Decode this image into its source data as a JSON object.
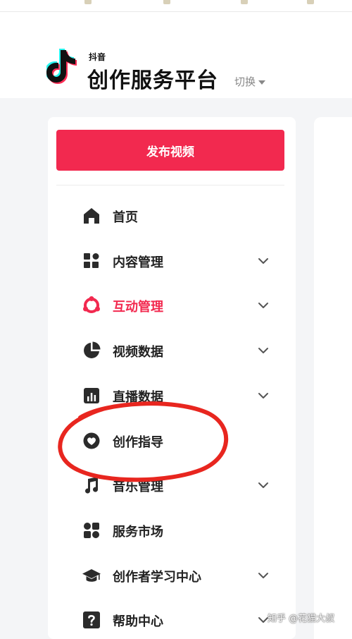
{
  "header": {
    "logo_small": "抖音",
    "logo_main": "创作服务平台",
    "switch_label": "切换"
  },
  "sidebar": {
    "publish_label": "发布视频",
    "items": [
      {
        "label": "首页",
        "icon": "home-icon",
        "expandable": false,
        "active": false
      },
      {
        "label": "内容管理",
        "icon": "content-grid-icon",
        "expandable": true,
        "active": false
      },
      {
        "label": "互动管理",
        "icon": "interaction-icon",
        "expandable": true,
        "active": true
      },
      {
        "label": "视频数据",
        "icon": "pie-chart-icon",
        "expandable": true,
        "active": false
      },
      {
        "label": "直播数据",
        "icon": "bar-chart-icon",
        "expandable": true,
        "active": false
      },
      {
        "label": "创作指导",
        "icon": "heart-icon",
        "expandable": false,
        "active": false
      },
      {
        "label": "音乐管理",
        "icon": "music-note-icon",
        "expandable": true,
        "active": false
      },
      {
        "label": "服务市场",
        "icon": "service-grid-icon",
        "expandable": false,
        "active": false
      },
      {
        "label": "创作者学习中心",
        "icon": "graduation-cap-icon",
        "expandable": true,
        "active": false
      },
      {
        "label": "帮助中心",
        "icon": "help-icon",
        "expandable": true,
        "active": false
      }
    ]
  },
  "watermark": "知乎 @花猫大叔",
  "colors": {
    "accent": "#f2294f",
    "annotation_red": "#e8261f",
    "text": "#222222",
    "muted": "#888888"
  }
}
